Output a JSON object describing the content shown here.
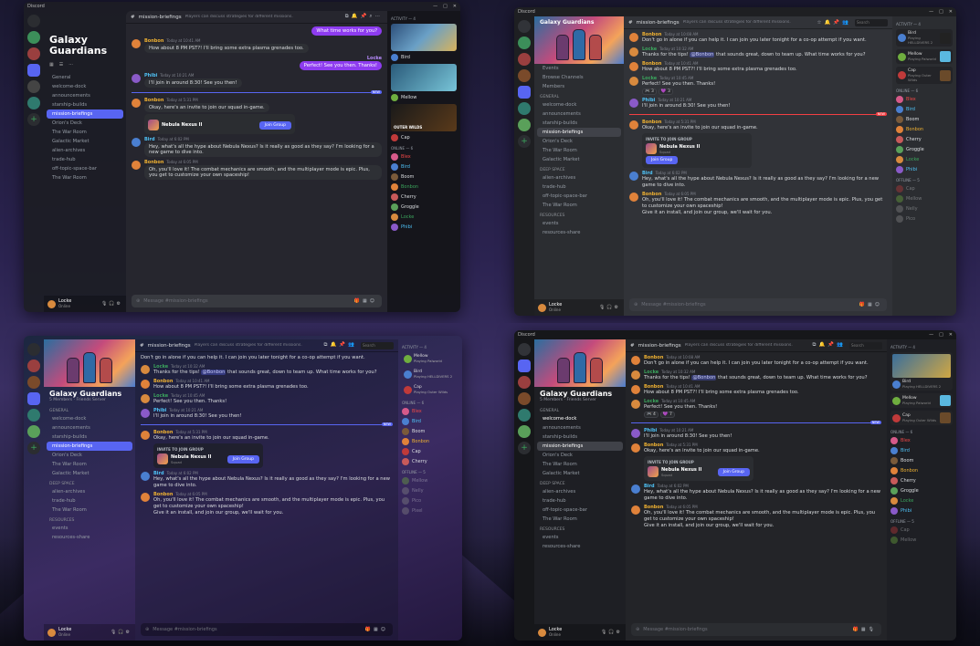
{
  "app": {
    "title": "Discord"
  },
  "guild": {
    "name": "Galaxy Guardians",
    "stats": "5 Members  ·  Friends Server"
  },
  "nav": {
    "events": "Events",
    "browse": "Browse Channels",
    "members": "Members"
  },
  "categories": {
    "general": "General",
    "deepspace": "Deep Space",
    "resources": "Resources"
  },
  "channels": {
    "welcome": "welcome-dock",
    "announcements": "announcements",
    "starship": "starship-builds",
    "briefings": "mission-briefings",
    "orion": "Orion's Deck",
    "warroom": "The War Room",
    "market": "Galactic Market",
    "alien": "alien-archives",
    "trade": "trade-hub",
    "offtopic": "off-topic-space-bar",
    "events": "events",
    "resshare": "resources-share"
  },
  "header": {
    "channel": "mission-briefings",
    "topic": "Players can discuss strategies for different missions.",
    "search": "Search"
  },
  "user": {
    "name": "Locke",
    "status": "Online"
  },
  "composer": {
    "placeholder": "Message #mission-briefings"
  },
  "msg": {
    "bonbon1_name": "Bonbon",
    "bonbon1_time": "Today at 10:08 AM",
    "bonbon1_text": "Don't go in alone if you can help it. I can join you later tonight for a co-op attempt if you want.",
    "locke1_name": "Locke",
    "locke1_time": "Today at 10:32 AM",
    "locke1_pre": "Thanks for the tips! ",
    "locke1_mention": "@Bonbon",
    "locke1_post": " that sounds great, down to team up. What time works for you?",
    "bonbon2_name": "Bonbon",
    "bonbon2_time": "Today at 10:41 AM",
    "bonbon2_text": "How about 8 PM PST?! I'll bring some extra plasma grenades too.",
    "locke2_name": "Locke",
    "locke2_time": "Today at 10:45 AM",
    "locke2_text": "Perfect! See you then. Thanks!",
    "phibi_name": "Phibi",
    "phibi_time": "Today at 10:21 AM",
    "phibi_text": "I'll join in around 8:30! See you then!",
    "new": "NEW",
    "bonbon3_name": "Bonbon",
    "bonbon3_time": "Today at 5:31 PM",
    "bonbon3_text": "Okay, here's an invite to join our squad in-game.",
    "invite_label": "INVITE TO JOIN GROUP",
    "invite_name": "Nebula Nexus II",
    "invite_sub": "Squad",
    "invite_btn": "Join Group",
    "bird_name": "Bird",
    "bird_time": "Today at 6:02 PM",
    "bird_text": "Hey, what's all the hype about Nebula Nexus? Is it really as good as they say? I'm looking for a new game to dive into.",
    "bonbon4_name": "Bonbon",
    "bonbon4_time": "Today at 6:05 PM",
    "bonbon4_text1": "Oh, you'll love it! The combat mechanics are smooth, and the multiplayer mode is epic. Plus, you get to customize your own spaceship!",
    "bonbon4_text2": "Give it an install, and join our group, we'll wait for you.",
    "what_time": "What time works for you?"
  },
  "members": {
    "activity": "Activity — 4",
    "online": "Online — 6",
    "offline": "Offline — 5",
    "act_bird": "Bird",
    "act_bird_game": "Playing HELLDIVERS 2",
    "act_mellow": "Mellow",
    "act_mellow_game": "Playing Palworld",
    "act_cap": "Cap",
    "act_cap_game": "Playing Outer Wilds",
    "game_outer": "OUTER WILDS",
    "online_list": [
      "Blex",
      "Bird",
      "Boom",
      "Bonbon",
      "Cherry",
      "Groggle",
      "Locke",
      "Phibi"
    ],
    "offline_list": [
      "Cap",
      "Mellow",
      "Nelly",
      "Pico",
      "Pixel"
    ]
  }
}
